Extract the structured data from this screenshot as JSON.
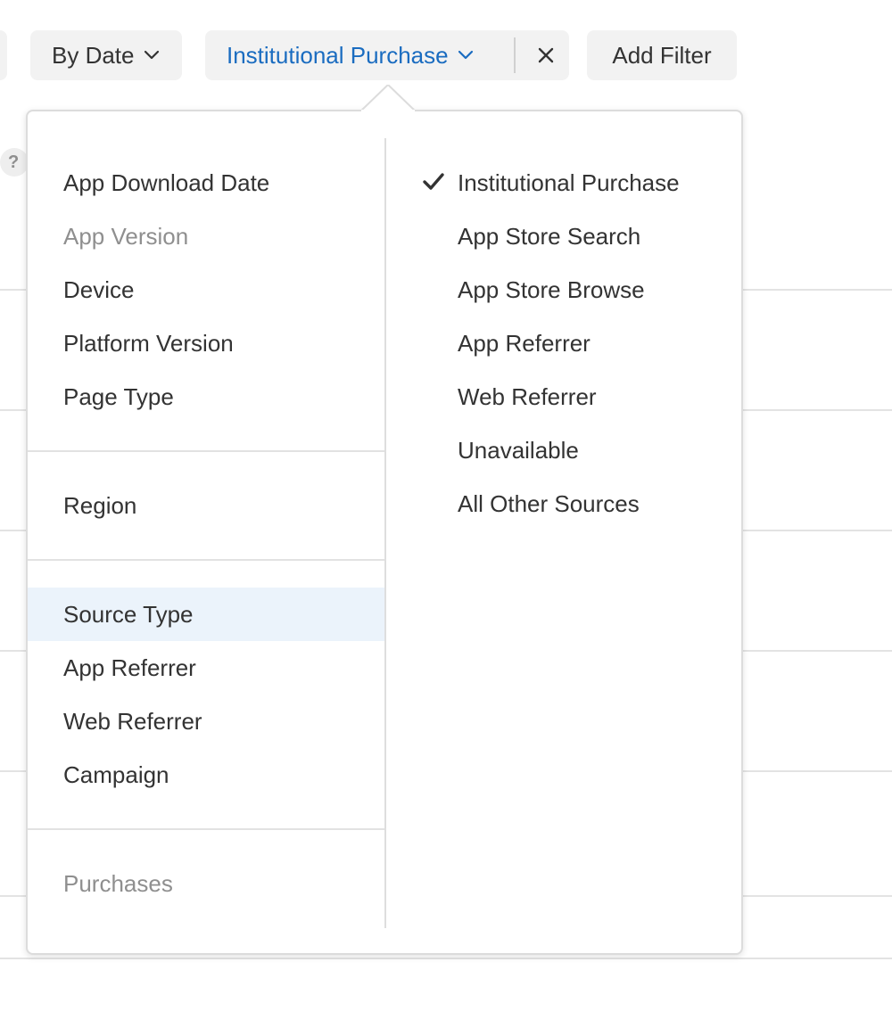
{
  "toolbar": {
    "by_date_label": "By Date",
    "filter_label": "Institutional Purchase",
    "add_filter_label": "Add Filter"
  },
  "help_icon": {
    "glyph": "?"
  },
  "dimension_menu": {
    "groups": [
      {
        "items": [
          {
            "label": "App Download Date",
            "enabled": true
          },
          {
            "label": "App Version",
            "enabled": false
          },
          {
            "label": "Device",
            "enabled": true
          },
          {
            "label": "Platform Version",
            "enabled": true
          },
          {
            "label": "Page Type",
            "enabled": true
          }
        ]
      },
      {
        "items": [
          {
            "label": "Region",
            "enabled": true
          }
        ]
      },
      {
        "items": [
          {
            "label": "Source Type",
            "enabled": true,
            "selected": true
          },
          {
            "label": "App Referrer",
            "enabled": true
          },
          {
            "label": "Web Referrer",
            "enabled": true
          },
          {
            "label": "Campaign",
            "enabled": true
          }
        ]
      },
      {
        "items": [
          {
            "label": "Purchases",
            "enabled": false
          }
        ]
      }
    ]
  },
  "value_menu": {
    "items": [
      {
        "label": "Institutional Purchase",
        "checked": true
      },
      {
        "label": "App Store Search",
        "checked": false
      },
      {
        "label": "App Store Browse",
        "checked": false
      },
      {
        "label": "App Referrer",
        "checked": false
      },
      {
        "label": "Web Referrer",
        "checked": false
      },
      {
        "label": "Unavailable",
        "checked": false
      },
      {
        "label": "All Other Sources",
        "checked": false
      }
    ]
  },
  "colors": {
    "accent": "#1a6cc0",
    "selected_row": "#ebf3fb",
    "disabled_text": "#8f8f8f",
    "button_bg": "#f2f2f2"
  },
  "icons": [
    "chevron-down-icon",
    "close-icon",
    "checkmark-icon",
    "help-icon"
  ]
}
